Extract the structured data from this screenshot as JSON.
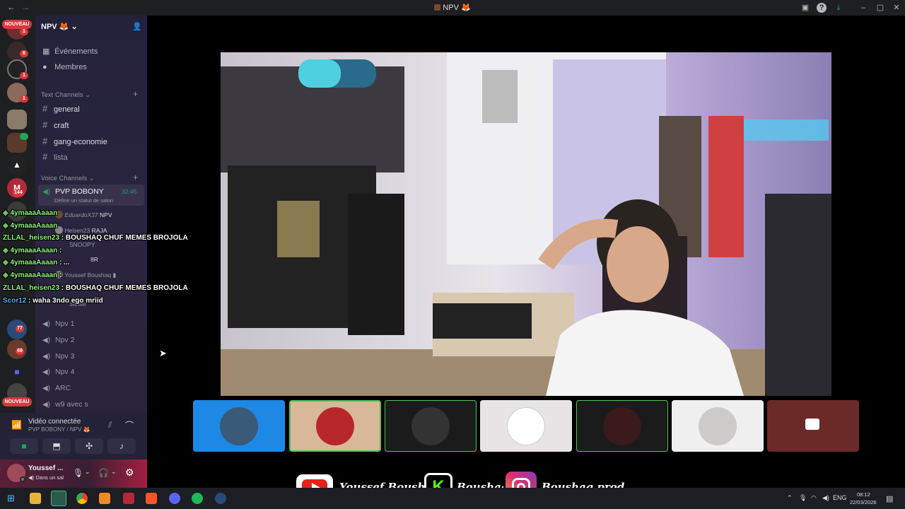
{
  "window": {
    "title": "NPV",
    "title_icon": "fox-emoji-icon"
  },
  "server": {
    "name": "NPV",
    "menu": [
      "Événements",
      "Membres"
    ]
  },
  "rail_badges": {
    "nouveau": "NOUVEAU",
    "counts": [
      "1",
      "6",
      "1",
      "1",
      "1",
      "144",
      "77",
      "69"
    ]
  },
  "text_channels": {
    "header": "Text Channels",
    "items": [
      "general",
      "craft",
      "gang-economie",
      "lista"
    ]
  },
  "voice_channels": {
    "header": "Voice Channels",
    "active": {
      "name": "PVP BOBONY",
      "timer": "32:45",
      "status": "Définir un statut de salon"
    },
    "members": [
      {
        "name": "EduardoX37",
        "tag": "NPV"
      },
      {
        "name": "Heisen23",
        "tag": "RAJA"
      },
      {
        "name": "SNOOPY",
        "tag": ""
      },
      {
        "name": "8R",
        "tag": ""
      },
      {
        "name": "Youssef Boushaq",
        "tag": ""
      },
      {
        "name": "3anter",
        "tag": ""
      }
    ],
    "others": [
      "Npv 1",
      "Npv 2",
      "Npv 3",
      "Npv 4",
      "ARC",
      "w9 avec s"
    ]
  },
  "voice_panel": {
    "status": "Vidéo connectée",
    "location": "PVP BOBONY / NPV"
  },
  "user_panel": {
    "name": "Youssef ...",
    "status": "Dans un sal"
  },
  "chat_overlay": [
    {
      "user": "4ymaaaAaaan",
      "msg": ""
    },
    {
      "user": "4ymaaaAaaan",
      "msg": ""
    },
    {
      "user": "ZLLAL_heisen23",
      "msg": " : BOUSHAQ CHUF MEMES BROJOLA"
    },
    {
      "user": "4ymaaaAaaan",
      "msg": " :"
    },
    {
      "user": "4ymaaaAaaan",
      "msg": " : ..."
    },
    {
      "user": "4ymaaaAaaan",
      "msg": " :"
    },
    {
      "user": "ZLLAL_heisen23",
      "msg": " : BOUSHAQ CHUF MEMES BROJOLA"
    },
    {
      "user": "Scor12",
      "msg": " : waha 3ndo ego mriid"
    }
  ],
  "social": {
    "youtube": "Youssef Boushaq",
    "kick": "Boushaq",
    "instagram": "Boushaq.prod"
  },
  "taskbar": {
    "lang": "ENG",
    "time": "08:12",
    "date": "22/03/2026"
  },
  "colors": {
    "accent_red": "#da373c",
    "chat_user": "#8ef37a",
    "voice_green": "#23a55a"
  }
}
